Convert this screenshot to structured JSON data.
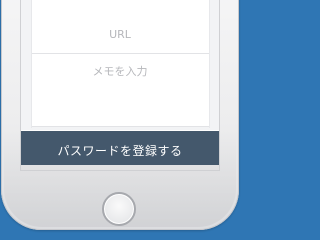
{
  "form": {
    "url_placeholder": "URL",
    "memo_placeholder": "メモを入力"
  },
  "actions": {
    "register_label": "パスワードを登録する"
  },
  "colors": {
    "background": "#2f76b4",
    "button": "#44586c",
    "placeholder_text": "#b6b7bb"
  },
  "icons": {
    "home": "home-button-icon"
  }
}
